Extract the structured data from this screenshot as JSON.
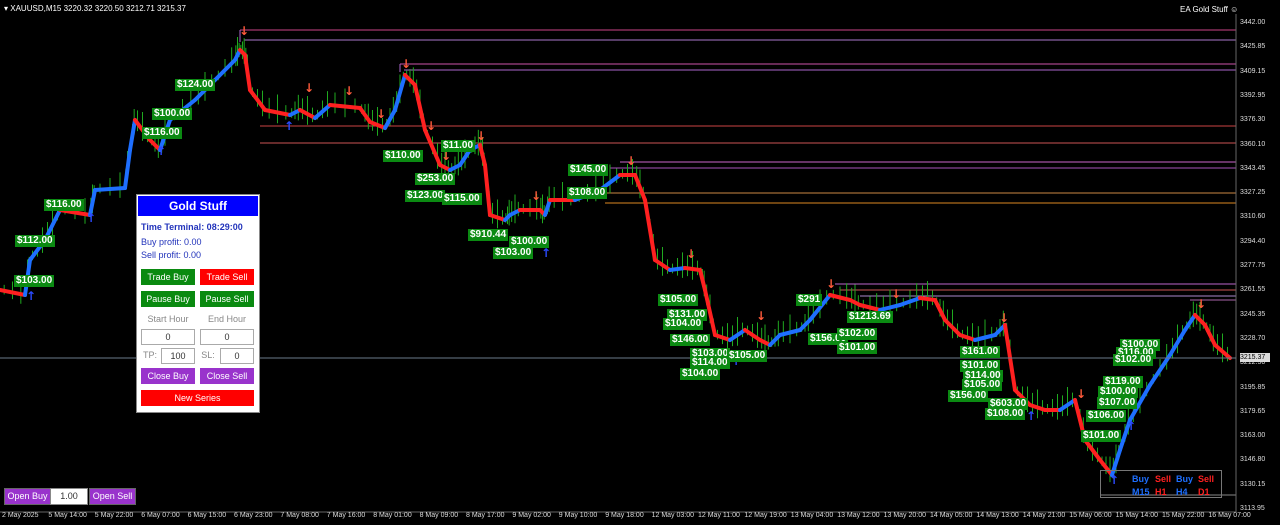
{
  "header": {
    "symbol_info": "XAUUSD,M15  3220.32 3220.50 3212.71 3215.37",
    "ea_name": "EA Gold Stuff"
  },
  "price_axis": [
    "3442.00",
    "3425.85",
    "3409.15",
    "3392.95",
    "3376.30",
    "3360.10",
    "3343.45",
    "3327.25",
    "3310.60",
    "3294.40",
    "3277.75",
    "3261.55",
    "3245.35",
    "3228.70",
    "3212.50",
    "3195.85",
    "3179.65",
    "3163.00",
    "3146.80",
    "3130.15",
    "3113.95"
  ],
  "current_price": "3215.37",
  "date_axis": [
    "2 May 2025",
    "5 May 14:00",
    "5 May 22:00",
    "6 May 07:00",
    "6 May 15:00",
    "6 May 23:00",
    "7 May 08:00",
    "7 May 16:00",
    "8 May 01:00",
    "8 May 09:00",
    "8 May 17:00",
    "9 May 02:00",
    "9 May 10:00",
    "9 May 18:00",
    "12 May 03:00",
    "12 May 11:00",
    "12 May 19:00",
    "13 May 04:00",
    "13 May 12:00",
    "13 May 20:00",
    "14 May 05:00",
    "14 May 13:00",
    "14 May 21:00",
    "15 May 06:00",
    "15 May 14:00",
    "15 May 22:00",
    "16 May 07:00"
  ],
  "profit_labels": [
    "$124.00",
    "$116.00",
    "$100.00",
    "$116.00",
    "$112.00",
    "$103.00",
    "$110.00",
    "$253.00",
    "$123.00",
    "$11.00",
    "$115.00",
    "$910.44",
    "$100.00",
    "$103.00",
    "$145.00",
    "$108.00",
    "$105.00",
    "$131.00",
    "$104.00",
    "$146.00",
    "$103.00",
    "$114.00",
    "$104.00",
    "$105.00",
    "$156.00",
    "$1213.69",
    "$102.00",
    "$101.00",
    "$161.00",
    "$101.00",
    "$114.00",
    "$105.00",
    "$156.00",
    "$603.00",
    "$108.00",
    "$100.00",
    "$116.00",
    "$102.00",
    "$119.00",
    "$100.00",
    "$107.00",
    "$106.00",
    "$101.00",
    "$291"
  ],
  "panel": {
    "title": "Gold Stuff",
    "time_terminal": "Time Terminal: 08:29:00",
    "buy_profit": "Buy profit: 0.00",
    "sell_profit": "Sell profit: 0.00",
    "trade_buy": "Trade Buy",
    "trade_sell": "Trade Sell",
    "pause_buy": "Pause Buy",
    "pause_sell": "Pause Sell",
    "start_hour_label": "Start Hour",
    "end_hour_label": "End Hour",
    "start_hour_value": "0",
    "end_hour_value": "0",
    "tp_label": "TP:",
    "tp_value": "100",
    "sl_label": "SL:",
    "sl_value": "0",
    "close_buy": "Close Buy",
    "close_sell": "Close Sell",
    "new_series": "New Series"
  },
  "bottom": {
    "open_buy": "Open Buy",
    "lot": "1.00",
    "open_sell": "Open Sell"
  },
  "timeframes": {
    "row1": [
      "Buy",
      "Sell",
      "Buy",
      "Sell"
    ],
    "row2": [
      "M15",
      "H1",
      "H4",
      "D1"
    ]
  },
  "colors": {
    "buy": "#1e6fff",
    "sell": "#ff2020",
    "profit_bg": "#0b8a12",
    "panel_head": "#0000ff"
  }
}
